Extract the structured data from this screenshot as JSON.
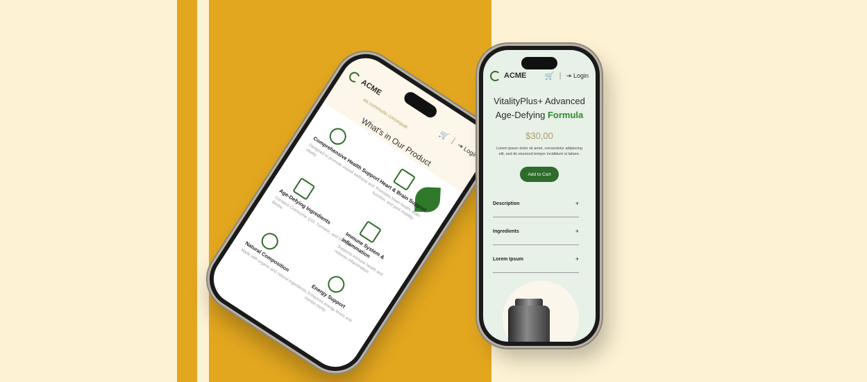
{
  "colors": {
    "background": "#fdf2d4",
    "stripe": "#e3a71f",
    "brand_green": "#2f6b2a",
    "accent_green": "#2f8a2a",
    "price": "#b09a6a"
  },
  "right_phone": {
    "logo": "ACME",
    "cart_icon": "cart-icon",
    "separator": "|",
    "login": "Login",
    "title": "VitalityPlus+ Advanced Age-Defying",
    "title_emphasis": "Formula",
    "price": "$30,00",
    "description": "Lorem ipsum dolor sit amet, consectetur adipiscing elit, sed do eiusmod tempor incididunt ut labore.",
    "cta": "Add to Cart",
    "accordion": [
      {
        "label": "Description",
        "toggle": "+"
      },
      {
        "label": "Ingredients",
        "toggle": "+"
      },
      {
        "label": "Lorem Ipsum",
        "toggle": "+"
      }
    ]
  },
  "left_phone": {
    "logo": "ACME",
    "login": "Login",
    "subtitle": "ea commodo consequat",
    "section_title": "What's in Our Product",
    "features": [
      {
        "title": "Comprehensive Health Support",
        "desc": "Designed to promote overall wellness and vitality."
      },
      {
        "title": "Heart & Brain Support",
        "desc": "Promotes heart health, brain function, and joint mobility."
      },
      {
        "title": "Age-Defying Ingredients",
        "desc": "Contains Coenzyme Q10, Turmeric, and Ginkgo Biloba."
      },
      {
        "title": "Immune System & Inflammation",
        "desc": "Supports immune health and reduces inflammation."
      },
      {
        "title": "Natural Composition",
        "desc": "Made with organic and natural ingredients."
      },
      {
        "title": "Energy Support",
        "desc": "Enhances energy levels and mental clarity."
      }
    ]
  }
}
